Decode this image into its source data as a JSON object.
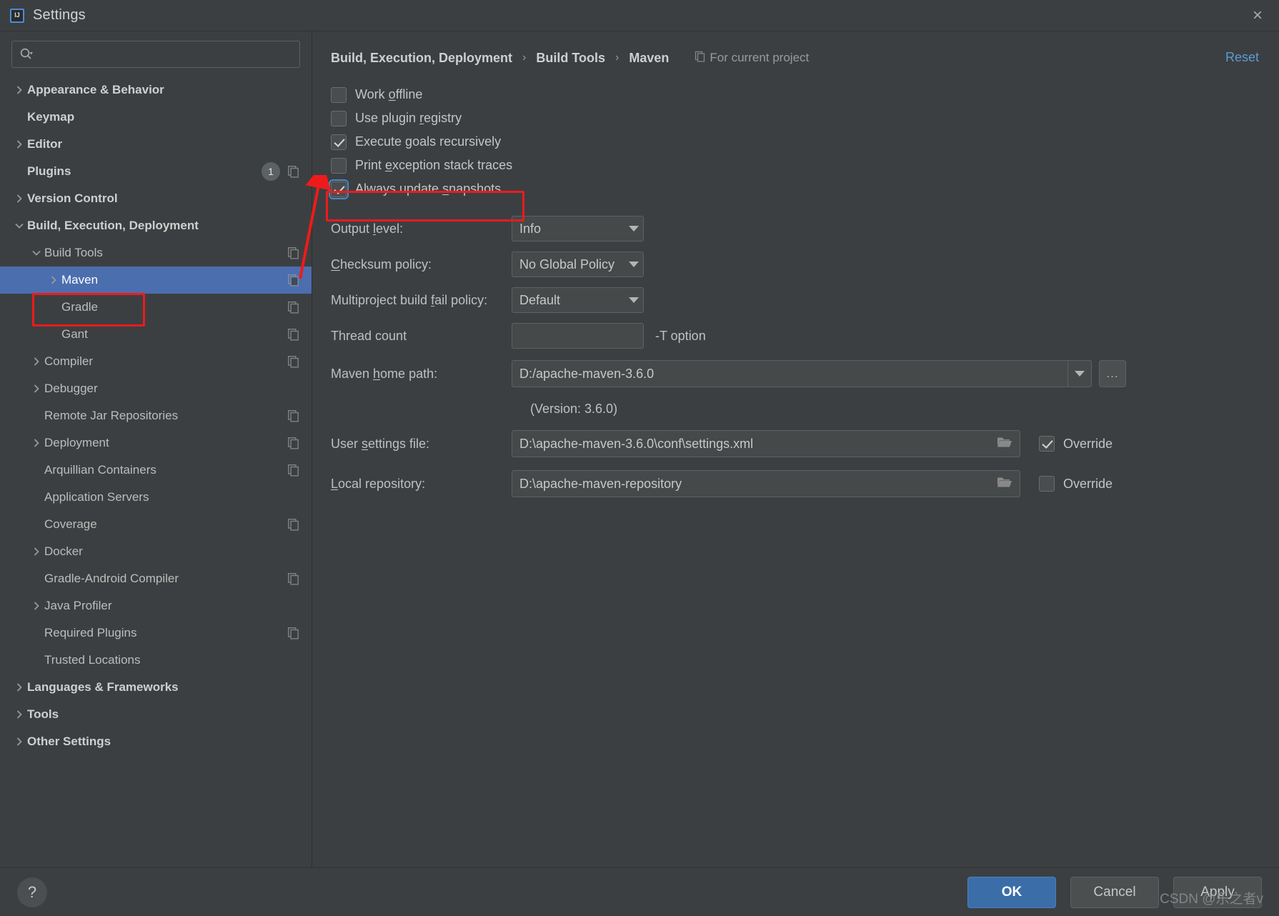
{
  "window": {
    "title": "Settings",
    "logo_text": "IJ",
    "close_label": "×"
  },
  "search": {
    "value": "",
    "placeholder": ""
  },
  "sidebar": {
    "items": [
      {
        "label": "Appearance & Behavior",
        "level": 0,
        "arrow": "right",
        "bold": true,
        "badge": "",
        "copy": false,
        "selected": false
      },
      {
        "label": "Keymap",
        "level": 0,
        "arrow": "none",
        "bold": true,
        "badge": "",
        "copy": false,
        "selected": false
      },
      {
        "label": "Editor",
        "level": 0,
        "arrow": "right",
        "bold": true,
        "badge": "",
        "copy": false,
        "selected": false
      },
      {
        "label": "Plugins",
        "level": 0,
        "arrow": "none",
        "bold": true,
        "badge": "1",
        "copy": true,
        "selected": false
      },
      {
        "label": "Version Control",
        "level": 0,
        "arrow": "right",
        "bold": true,
        "badge": "",
        "copy": false,
        "selected": false
      },
      {
        "label": "Build, Execution, Deployment",
        "level": 0,
        "arrow": "down",
        "bold": true,
        "badge": "",
        "copy": false,
        "selected": false
      },
      {
        "label": "Build Tools",
        "level": 1,
        "arrow": "down",
        "bold": false,
        "badge": "",
        "copy": true,
        "selected": false
      },
      {
        "label": "Maven",
        "level": 2,
        "arrow": "right",
        "bold": false,
        "badge": "",
        "copy": true,
        "selected": true
      },
      {
        "label": "Gradle",
        "level": 2,
        "arrow": "none",
        "bold": false,
        "badge": "",
        "copy": true,
        "selected": false
      },
      {
        "label": "Gant",
        "level": 2,
        "arrow": "none",
        "bold": false,
        "badge": "",
        "copy": true,
        "selected": false
      },
      {
        "label": "Compiler",
        "level": 1,
        "arrow": "right",
        "bold": false,
        "badge": "",
        "copy": true,
        "selected": false
      },
      {
        "label": "Debugger",
        "level": 1,
        "arrow": "right",
        "bold": false,
        "badge": "",
        "copy": false,
        "selected": false
      },
      {
        "label": "Remote Jar Repositories",
        "level": 1,
        "arrow": "none",
        "bold": false,
        "badge": "",
        "copy": true,
        "selected": false
      },
      {
        "label": "Deployment",
        "level": 1,
        "arrow": "right",
        "bold": false,
        "badge": "",
        "copy": true,
        "selected": false
      },
      {
        "label": "Arquillian Containers",
        "level": 1,
        "arrow": "none",
        "bold": false,
        "badge": "",
        "copy": true,
        "selected": false
      },
      {
        "label": "Application Servers",
        "level": 1,
        "arrow": "none",
        "bold": false,
        "badge": "",
        "copy": false,
        "selected": false
      },
      {
        "label": "Coverage",
        "level": 1,
        "arrow": "none",
        "bold": false,
        "badge": "",
        "copy": true,
        "selected": false
      },
      {
        "label": "Docker",
        "level": 1,
        "arrow": "right",
        "bold": false,
        "badge": "",
        "copy": false,
        "selected": false
      },
      {
        "label": "Gradle-Android Compiler",
        "level": 1,
        "arrow": "none",
        "bold": false,
        "badge": "",
        "copy": true,
        "selected": false
      },
      {
        "label": "Java Profiler",
        "level": 1,
        "arrow": "right",
        "bold": false,
        "badge": "",
        "copy": false,
        "selected": false
      },
      {
        "label": "Required Plugins",
        "level": 1,
        "arrow": "none",
        "bold": false,
        "badge": "",
        "copy": true,
        "selected": false
      },
      {
        "label": "Trusted Locations",
        "level": 1,
        "arrow": "none",
        "bold": false,
        "badge": "",
        "copy": false,
        "selected": false
      },
      {
        "label": "Languages & Frameworks",
        "level": 0,
        "arrow": "right",
        "bold": true,
        "badge": "",
        "copy": false,
        "selected": false
      },
      {
        "label": "Tools",
        "level": 0,
        "arrow": "right",
        "bold": true,
        "badge": "",
        "copy": false,
        "selected": false
      },
      {
        "label": "Other Settings",
        "level": 0,
        "arrow": "right",
        "bold": true,
        "badge": "",
        "copy": false,
        "selected": false
      }
    ]
  },
  "header": {
    "crumb1": "Build, Execution, Deployment",
    "crumb2": "Build Tools",
    "crumb3": "Maven",
    "sep": "›",
    "scope_label": "For current project",
    "reset_label": "Reset"
  },
  "checkboxes": [
    {
      "label_pre": "Work ",
      "mnemonic": "o",
      "label_post": "ffline",
      "checked": false,
      "focused": false
    },
    {
      "label_pre": "Use plugin ",
      "mnemonic": "r",
      "label_post": "egistry",
      "checked": false,
      "focused": false
    },
    {
      "label_pre": "Execute ",
      "mnemonic": "g",
      "label_post": "oals recursively",
      "checked": true,
      "focused": false
    },
    {
      "label_pre": "Print ",
      "mnemonic": "e",
      "label_post": "xception stack traces",
      "checked": false,
      "focused": false
    },
    {
      "label_pre": "Always update ",
      "mnemonic": "s",
      "label_post": "napshots",
      "checked": true,
      "focused": true
    }
  ],
  "form": {
    "output_level": {
      "label_pre": "Output ",
      "mnemonic": "l",
      "label_post": "evel:",
      "value": "Info"
    },
    "checksum_policy": {
      "label_pre": "",
      "mnemonic": "C",
      "label_post": "hecksum policy:",
      "value": "No Global Policy"
    },
    "multiproject_fail_policy": {
      "label_pre": "Multiproject build ",
      "mnemonic": "f",
      "label_post": "ail policy:",
      "value": "Default"
    },
    "thread_count": {
      "label": "Thread count",
      "value": "",
      "hint": "-T option"
    },
    "maven_home": {
      "label_pre": "Maven ",
      "mnemonic": "h",
      "label_post": "ome path:",
      "value": "D:/apache-maven-3.6.0",
      "ellipsis_label": "...",
      "version_note": "(Version: 3.6.0)"
    },
    "user_settings": {
      "label_pre": "User ",
      "mnemonic": "s",
      "label_post": "ettings file:",
      "value": "D:\\apache-maven-3.6.0\\conf\\settings.xml",
      "override_label": "Override",
      "override_checked": true
    },
    "local_repository": {
      "label_pre": "",
      "mnemonic": "L",
      "label_post": "ocal repository:",
      "value": "D:\\apache-maven-repository",
      "override_label": "Override",
      "override_checked": false
    }
  },
  "footer": {
    "help_label": "?",
    "ok_label": "OK",
    "cancel_label": "Cancel",
    "apply_label": "Apply"
  },
  "watermark": "CSDN @乐之者v",
  "colors": {
    "accent": "#4b6eaf",
    "link": "#5b9bd5",
    "annotation": "#ee1b1b",
    "background": "#3c3f41"
  }
}
